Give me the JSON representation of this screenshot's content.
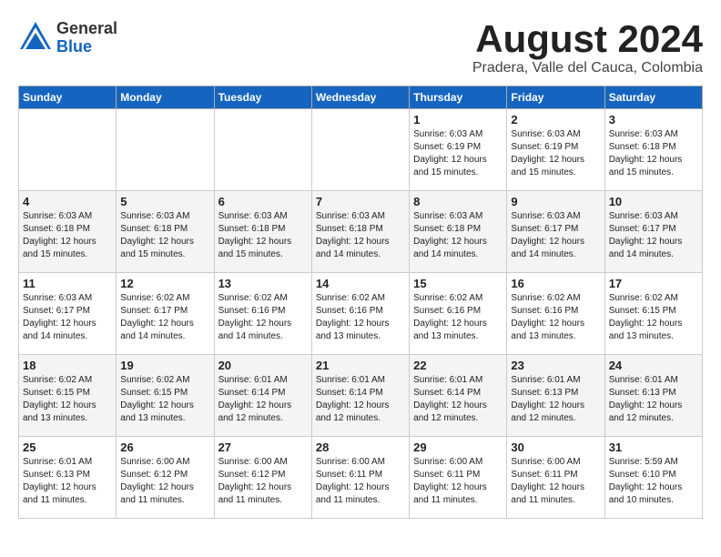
{
  "header": {
    "logo_general": "General",
    "logo_blue": "Blue",
    "month_year": "August 2024",
    "location": "Pradera, Valle del Cauca, Colombia"
  },
  "weekdays": [
    "Sunday",
    "Monday",
    "Tuesday",
    "Wednesday",
    "Thursday",
    "Friday",
    "Saturday"
  ],
  "weeks": [
    [
      {
        "day": "",
        "info": ""
      },
      {
        "day": "",
        "info": ""
      },
      {
        "day": "",
        "info": ""
      },
      {
        "day": "",
        "info": ""
      },
      {
        "day": "1",
        "info": "Sunrise: 6:03 AM\nSunset: 6:19 PM\nDaylight: 12 hours\nand 15 minutes."
      },
      {
        "day": "2",
        "info": "Sunrise: 6:03 AM\nSunset: 6:19 PM\nDaylight: 12 hours\nand 15 minutes."
      },
      {
        "day": "3",
        "info": "Sunrise: 6:03 AM\nSunset: 6:18 PM\nDaylight: 12 hours\nand 15 minutes."
      }
    ],
    [
      {
        "day": "4",
        "info": "Sunrise: 6:03 AM\nSunset: 6:18 PM\nDaylight: 12 hours\nand 15 minutes."
      },
      {
        "day": "5",
        "info": "Sunrise: 6:03 AM\nSunset: 6:18 PM\nDaylight: 12 hours\nand 15 minutes."
      },
      {
        "day": "6",
        "info": "Sunrise: 6:03 AM\nSunset: 6:18 PM\nDaylight: 12 hours\nand 15 minutes."
      },
      {
        "day": "7",
        "info": "Sunrise: 6:03 AM\nSunset: 6:18 PM\nDaylight: 12 hours\nand 14 minutes."
      },
      {
        "day": "8",
        "info": "Sunrise: 6:03 AM\nSunset: 6:18 PM\nDaylight: 12 hours\nand 14 minutes."
      },
      {
        "day": "9",
        "info": "Sunrise: 6:03 AM\nSunset: 6:17 PM\nDaylight: 12 hours\nand 14 minutes."
      },
      {
        "day": "10",
        "info": "Sunrise: 6:03 AM\nSunset: 6:17 PM\nDaylight: 12 hours\nand 14 minutes."
      }
    ],
    [
      {
        "day": "11",
        "info": "Sunrise: 6:03 AM\nSunset: 6:17 PM\nDaylight: 12 hours\nand 14 minutes."
      },
      {
        "day": "12",
        "info": "Sunrise: 6:02 AM\nSunset: 6:17 PM\nDaylight: 12 hours\nand 14 minutes."
      },
      {
        "day": "13",
        "info": "Sunrise: 6:02 AM\nSunset: 6:16 PM\nDaylight: 12 hours\nand 14 minutes."
      },
      {
        "day": "14",
        "info": "Sunrise: 6:02 AM\nSunset: 6:16 PM\nDaylight: 12 hours\nand 13 minutes."
      },
      {
        "day": "15",
        "info": "Sunrise: 6:02 AM\nSunset: 6:16 PM\nDaylight: 12 hours\nand 13 minutes."
      },
      {
        "day": "16",
        "info": "Sunrise: 6:02 AM\nSunset: 6:16 PM\nDaylight: 12 hours\nand 13 minutes."
      },
      {
        "day": "17",
        "info": "Sunrise: 6:02 AM\nSunset: 6:15 PM\nDaylight: 12 hours\nand 13 minutes."
      }
    ],
    [
      {
        "day": "18",
        "info": "Sunrise: 6:02 AM\nSunset: 6:15 PM\nDaylight: 12 hours\nand 13 minutes."
      },
      {
        "day": "19",
        "info": "Sunrise: 6:02 AM\nSunset: 6:15 PM\nDaylight: 12 hours\nand 13 minutes."
      },
      {
        "day": "20",
        "info": "Sunrise: 6:01 AM\nSunset: 6:14 PM\nDaylight: 12 hours\nand 12 minutes."
      },
      {
        "day": "21",
        "info": "Sunrise: 6:01 AM\nSunset: 6:14 PM\nDaylight: 12 hours\nand 12 minutes."
      },
      {
        "day": "22",
        "info": "Sunrise: 6:01 AM\nSunset: 6:14 PM\nDaylight: 12 hours\nand 12 minutes."
      },
      {
        "day": "23",
        "info": "Sunrise: 6:01 AM\nSunset: 6:13 PM\nDaylight: 12 hours\nand 12 minutes."
      },
      {
        "day": "24",
        "info": "Sunrise: 6:01 AM\nSunset: 6:13 PM\nDaylight: 12 hours\nand 12 minutes."
      }
    ],
    [
      {
        "day": "25",
        "info": "Sunrise: 6:01 AM\nSunset: 6:13 PM\nDaylight: 12 hours\nand 11 minutes."
      },
      {
        "day": "26",
        "info": "Sunrise: 6:00 AM\nSunset: 6:12 PM\nDaylight: 12 hours\nand 11 minutes."
      },
      {
        "day": "27",
        "info": "Sunrise: 6:00 AM\nSunset: 6:12 PM\nDaylight: 12 hours\nand 11 minutes."
      },
      {
        "day": "28",
        "info": "Sunrise: 6:00 AM\nSunset: 6:11 PM\nDaylight: 12 hours\nand 11 minutes."
      },
      {
        "day": "29",
        "info": "Sunrise: 6:00 AM\nSunset: 6:11 PM\nDaylight: 12 hours\nand 11 minutes."
      },
      {
        "day": "30",
        "info": "Sunrise: 6:00 AM\nSunset: 6:11 PM\nDaylight: 12 hours\nand 11 minutes."
      },
      {
        "day": "31",
        "info": "Sunrise: 5:59 AM\nSunset: 6:10 PM\nDaylight: 12 hours\nand 10 minutes."
      }
    ]
  ]
}
